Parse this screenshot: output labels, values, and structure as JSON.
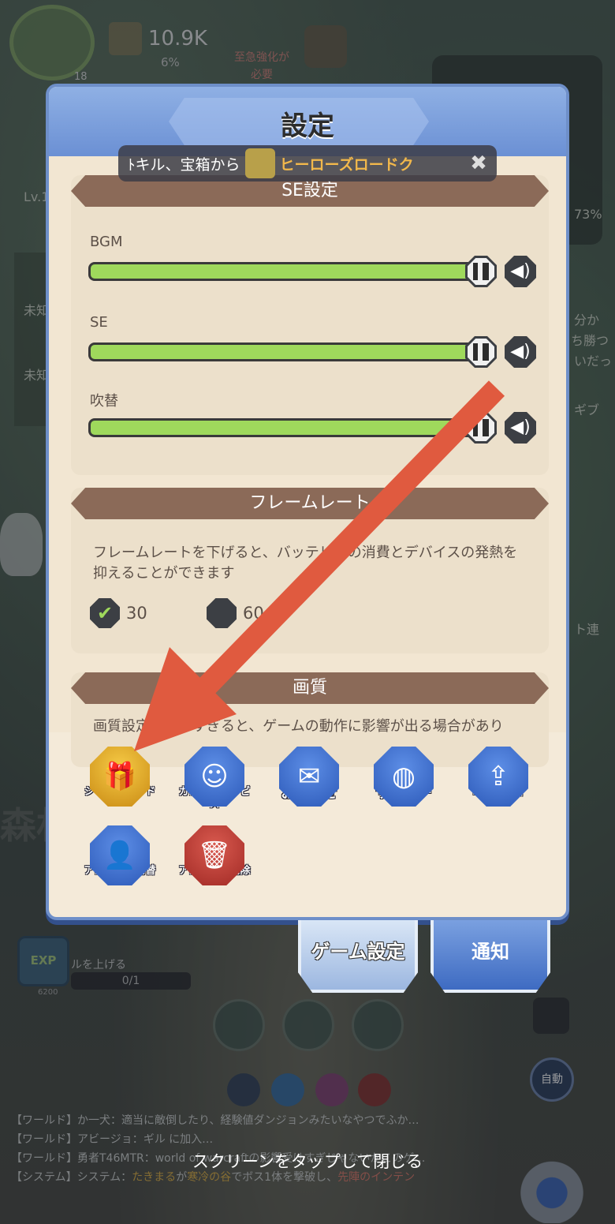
{
  "hud": {
    "level": "18",
    "power": "10.9K",
    "power_pct": "6%",
    "warning": "至急強化が必要"
  },
  "side_texts": [
    "Lv.1",
    "未知",
    "未知",
    "73%",
    "分か",
    "ち勝つ",
    "いだっ",
    "ギブ",
    "ト連",
    "森林"
  ],
  "modal": {
    "title": "設定",
    "banner": {
      "prefix": "ﾄキル、宝箱から",
      "highlight": "ヒーローズロードク"
    },
    "sound": {
      "header": "SE設定",
      "rows": [
        {
          "label": "BGM",
          "level": 1.0
        },
        {
          "label": "SE",
          "level": 1.0
        },
        {
          "label": "吹替",
          "level": 1.0
        }
      ]
    },
    "framerate": {
      "header": "フレームレート",
      "description": "フレームレートを下げると、バッテリーの消費とデバイスの発熱を抑えることができます",
      "options": [
        {
          "label": "30",
          "selected": true
        },
        {
          "label": "60",
          "selected": false
        }
      ]
    },
    "quality": {
      "header": "画質",
      "description": "画質設定を上げすぎると、ゲームの動作に影響が出る場合があり"
    },
    "actions": [
      {
        "label": "シリアルコード",
        "icon": "gift-icon",
        "color": "gold"
      },
      {
        "label": "カスタマサービス",
        "icon": "headset-icon",
        "color": "blue"
      },
      {
        "label": "お知らせ",
        "icon": "scroll-icon",
        "color": "blue"
      },
      {
        "label": "サーバー",
        "icon": "globe-icon",
        "color": "blue"
      },
      {
        "label": "エラー報告",
        "icon": "upload-icon",
        "color": "blue"
      },
      {
        "label": "アカウント切替",
        "icon": "user-icon",
        "color": "blue"
      },
      {
        "label": "アカウント削除",
        "icon": "trash-icon",
        "color": "red"
      }
    ]
  },
  "tabs": {
    "game_settings": "ゲーム設定",
    "notifications": "通知"
  },
  "bottom": {
    "exp_badge": "EXP",
    "exp_number": "6200",
    "exp_text": "ルを上げる",
    "exp_progress": "0/1",
    "auto": "自動",
    "close_hint": "スクリーンをタップして閉じる"
  },
  "chat": [
    {
      "channel": "【ワールド】",
      "text": "か一犬：適当に敵倒したり、経験値ダンジョンみたいなやつでふか…"
    },
    {
      "channel": "【ワールド】",
      "text": "アビージョ：ギル に加入…"
    },
    {
      "channel": "【ワールド】",
      "text": "勇者T46MTR：world of warcraftの影響受けすぎじゃないかこのゲ…"
    },
    {
      "channel": "【システム】",
      "text_a": "システム：",
      "name_a": "たきまる",
      "text_b": "が",
      "name_b": "寒冷の谷",
      "text_c": "でボス1体を撃破し、",
      "name_c": "先陣のインテン"
    }
  ],
  "colors": {
    "accent_blue": "#6b90d4",
    "slider_green": "#9fd95c",
    "section_header": "#8b6a58",
    "arrow_red": "#e05a3f"
  }
}
